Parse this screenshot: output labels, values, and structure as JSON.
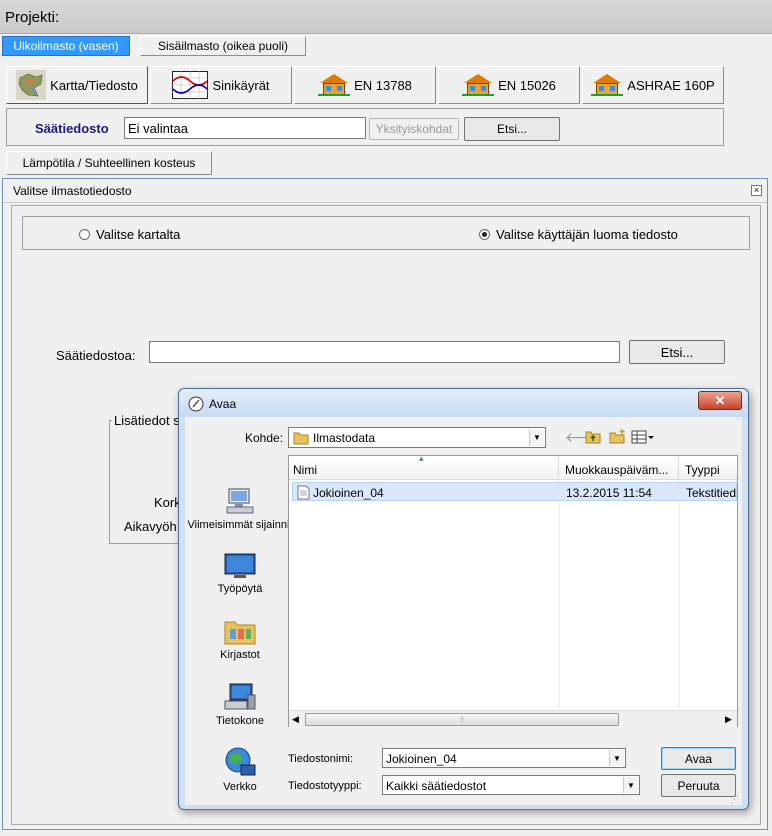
{
  "header": {
    "label": "Projekti:"
  },
  "tabs": [
    {
      "label": "Ulkoilmasto (vasen)",
      "active": true
    },
    {
      "label": "Sisäilmasto (oikea puoli)",
      "active": false
    }
  ],
  "toolbar": {
    "buttons": [
      {
        "label": "Kartta/Tiedosto",
        "icon": "map-icon"
      },
      {
        "label": "Sinikäyrät",
        "icon": "sine-curves-icon"
      },
      {
        "label": "EN 13788",
        "icon": "house-icon"
      },
      {
        "label": "EN 15026",
        "icon": "house-icon"
      },
      {
        "label": "ASHRAE 160P",
        "icon": "house-icon"
      }
    ]
  },
  "weather_row": {
    "label": "Säätiedosto",
    "value": "Ei valintaa",
    "details_button": "Yksityiskohdat",
    "browse_button": "Etsi..."
  },
  "subtab": {
    "label": "Lämpötila / Suhteellinen kosteus"
  },
  "dialog": {
    "title": "Valitse ilmastotiedosto",
    "radio_map": "Valitse kartalta",
    "radio_user": "Valitse käyttäjän luoma tiedosto",
    "file_label": "Säätiedostoa:",
    "file_value": "",
    "browse_button": "Etsi...",
    "extra_group": "Lisätiedot s",
    "height_label": "Kork",
    "timezone_label": "Aikavyöh"
  },
  "open_dialog": {
    "title": "Avaa",
    "location_label": "Kohde:",
    "location_value": "Ilmastodata",
    "places": [
      "Viimeisimmät sijainnit",
      "Työpöytä",
      "Kirjastot",
      "Tietokone",
      "Verkko"
    ],
    "columns": [
      "Nimi",
      "Muokkauspäiväm...",
      "Tyyppi"
    ],
    "files": [
      {
        "name": "Jokioinen_04",
        "date": "13.2.2015 11:54",
        "type": "Tekstitied"
      }
    ],
    "filename_label": "Tiedostonimi:",
    "filename_value": "Jokioinen_04",
    "filetype_label": "Tiedostotyyppi:",
    "filetype_value": "Kaikki säätiedostot",
    "open_button": "Avaa",
    "cancel_button": "Peruuta"
  },
  "colors": {
    "active_tab": "#3399ff",
    "dialog_border": "#6e8fb6",
    "selection": "#d9e8fb"
  }
}
